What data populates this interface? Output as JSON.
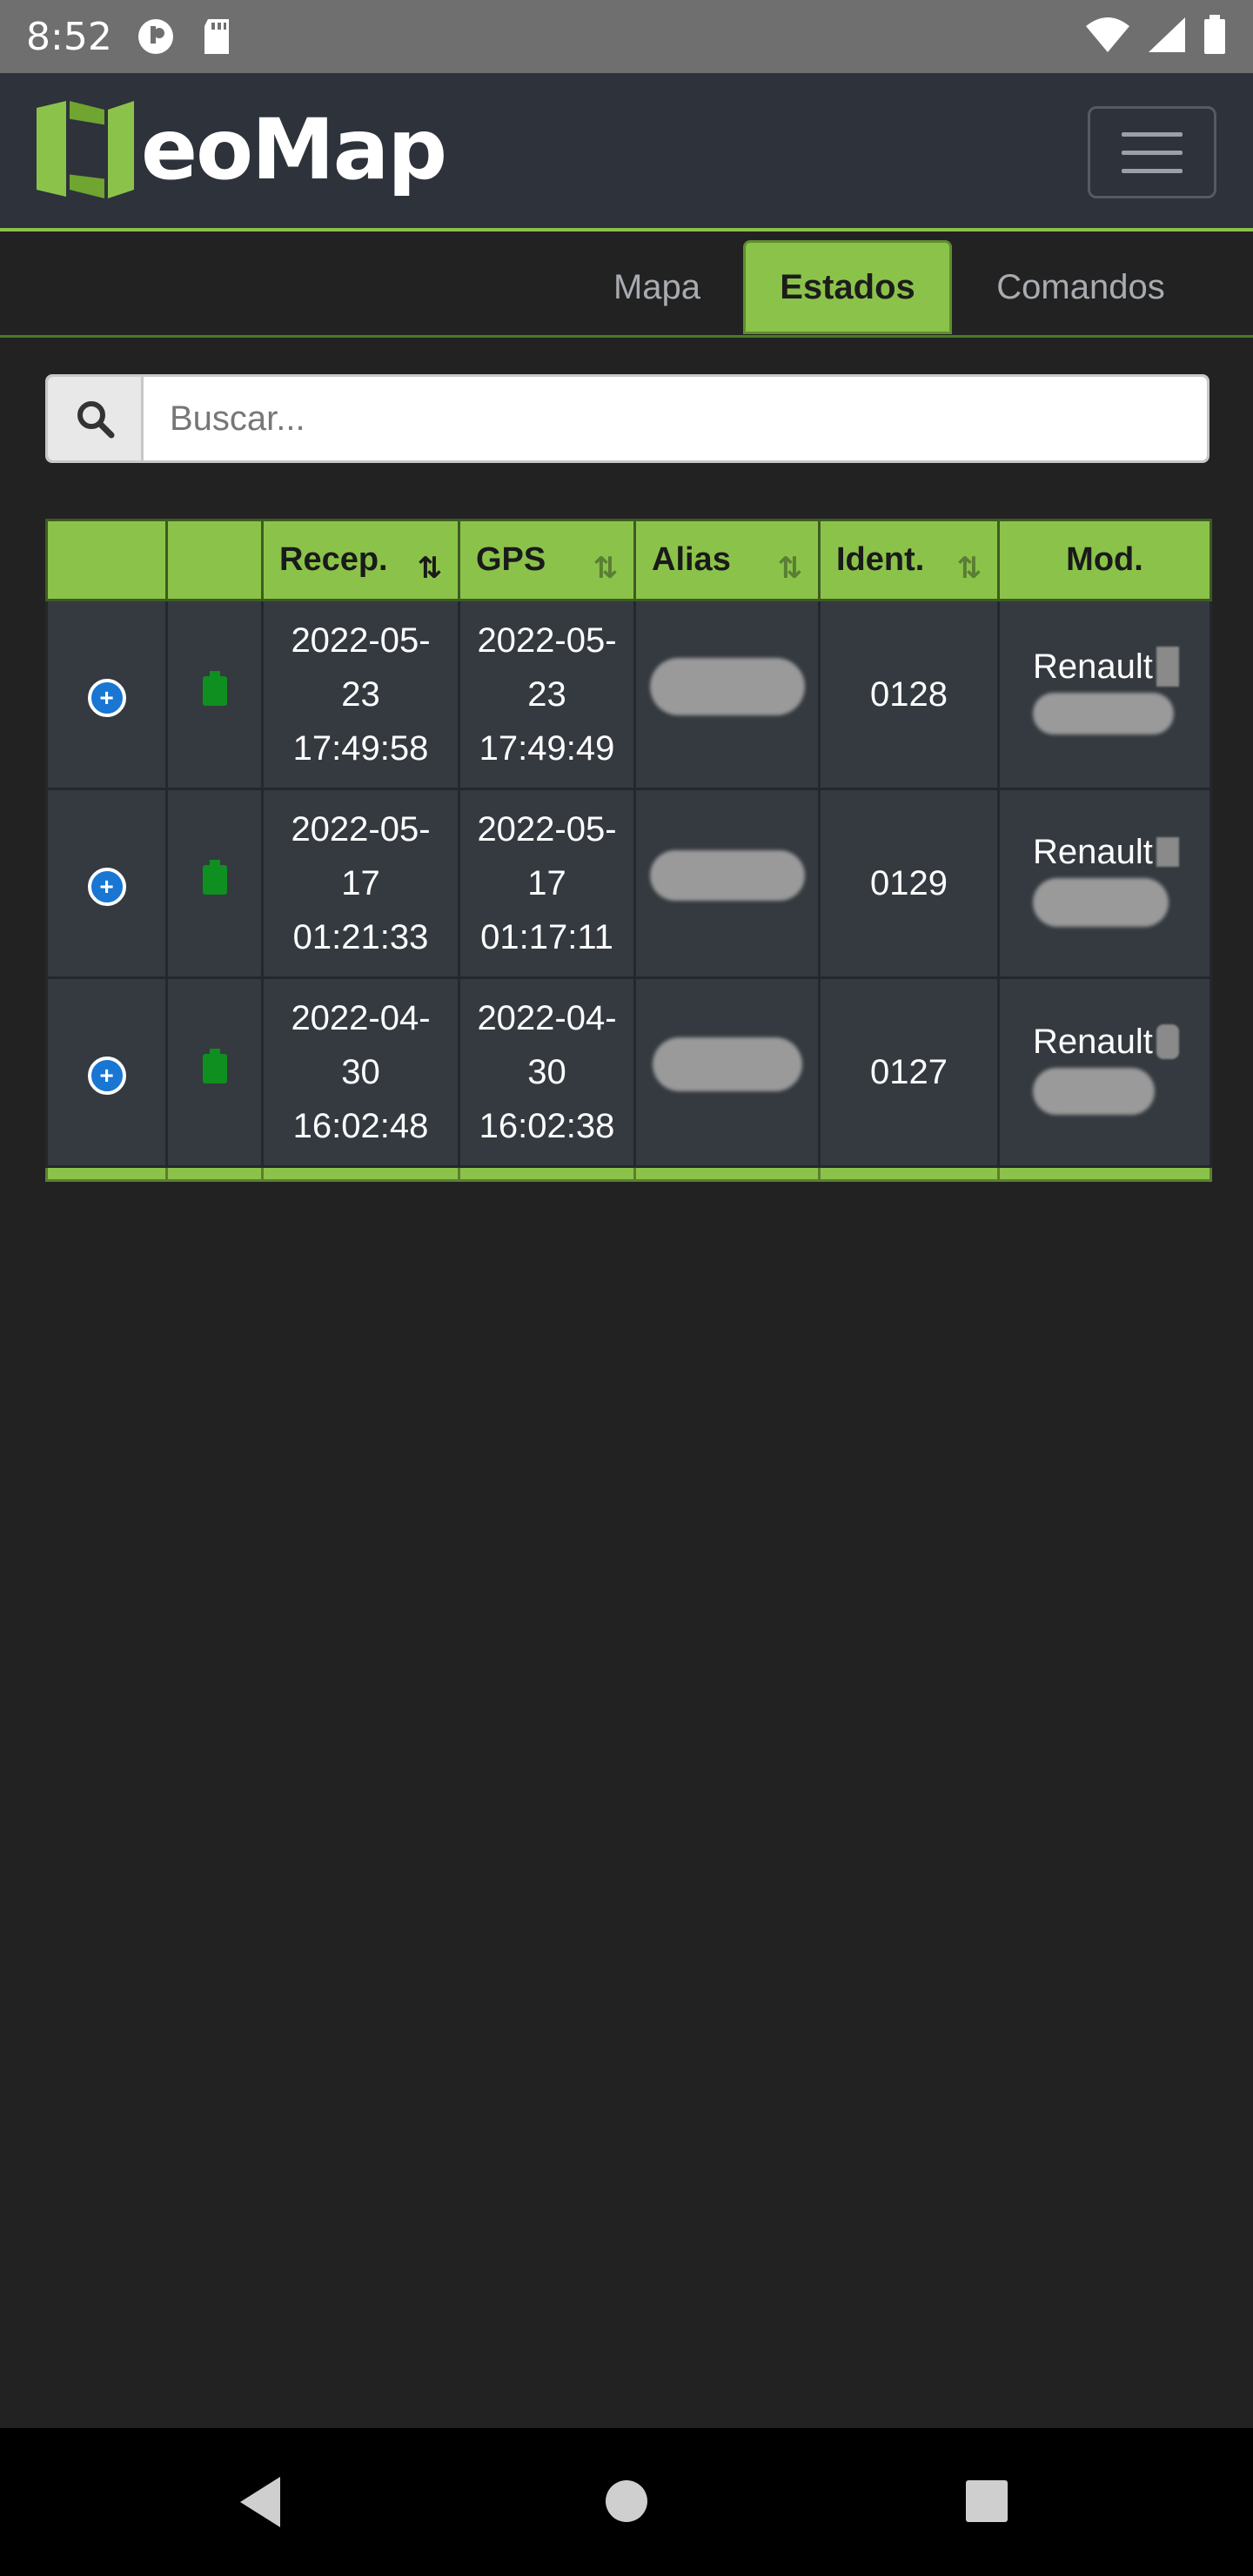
{
  "status_bar": {
    "time": "8:52",
    "icons": [
      "notification-icon",
      "sd-card-icon",
      "wifi-icon",
      "signal-icon",
      "battery-icon"
    ]
  },
  "header": {
    "logo_text": "eoMap",
    "menu_icon": "hamburger-menu-icon"
  },
  "tabs": [
    {
      "label": "Mapa",
      "active": false
    },
    {
      "label": "Estados",
      "active": true
    },
    {
      "label": "Comandos",
      "active": false
    }
  ],
  "search": {
    "placeholder": "Buscar...",
    "value": "",
    "icon": "search-icon"
  },
  "table": {
    "columns": [
      {
        "label": "",
        "sortable": false
      },
      {
        "label": "",
        "sortable": false
      },
      {
        "label": "Recep.",
        "sortable": true
      },
      {
        "label": "GPS",
        "sortable": true
      },
      {
        "label": "Alias",
        "sortable": true
      },
      {
        "label": "Ident.",
        "sortable": true
      },
      {
        "label": "Mod.",
        "sortable": false
      }
    ],
    "sort_symbol": "⇅",
    "rows": [
      {
        "recep_date": "2022-05-",
        "recep_day": "23",
        "recep_time": "17:49:58",
        "gps_date": "2022-05-",
        "gps_day": "23",
        "gps_time": "17:49:49",
        "ident": "0128",
        "model": "Renault"
      },
      {
        "recep_date": "2022-05-",
        "recep_day": "17",
        "recep_time": "01:21:33",
        "gps_date": "2022-05-",
        "gps_day": "17",
        "gps_time": "01:17:11",
        "ident": "0129",
        "model": "Renault"
      },
      {
        "recep_date": "2022-04-",
        "recep_day": "30",
        "recep_time": "16:02:48",
        "gps_date": "2022-04-",
        "gps_day": "30",
        "gps_time": "16:02:38",
        "ident": "0127",
        "model": "Renault"
      }
    ]
  },
  "colors": {
    "accent": "#8bc34a",
    "navbar": "#2e323a",
    "page_bg": "#222222",
    "row_bg": "#343a40",
    "status_ok": "#0f8f1f",
    "expand_button": "#1976d2"
  },
  "system_nav": {
    "icons": [
      "back-icon",
      "home-icon",
      "recents-icon"
    ]
  }
}
